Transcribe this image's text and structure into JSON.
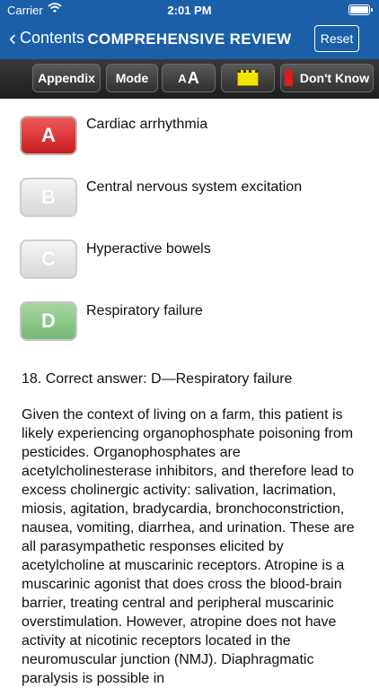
{
  "status_bar": {
    "carrier": "Carrier",
    "time": "2:01 PM"
  },
  "nav": {
    "back_label": "Contents",
    "title": "COMPREHENSIVE REVIEW",
    "reset_label": "Reset"
  },
  "toolbar": {
    "appendix_label": "Appendix",
    "mode_label": "Mode",
    "font_small": "A",
    "font_large": "A",
    "dont_know_label": "Don't Know"
  },
  "options": [
    {
      "letter": "A",
      "text": "Cardiac arrhythmia",
      "state": "selected-incorrect"
    },
    {
      "letter": "B",
      "text": "Central nervous system excitation",
      "state": "inactive"
    },
    {
      "letter": "C",
      "text": "Hyperactive bowels",
      "state": "inactive"
    },
    {
      "letter": "D",
      "text": "Respiratory failure",
      "state": "correct"
    }
  ],
  "answer_line": "18. Correct answer: D—Respiratory failure",
  "explanation": "Given the context of living on a farm, this patient is likely experiencing organophosphate poisoning from pesticides. Organophosphates are acetylcholinesterase inhibitors, and therefore lead to excess cholinergic activity: salivation, lacrimation, miosis, agitation, bradycardia, bronchoconstriction, nausea, vomiting, diarrhea, and urination. These are all parasympathetic responses elicited by acetylcholine at muscarinic receptors. Atropine is a muscarinic agonist that does cross the blood-brain barrier, treating central and peripheral muscarinic overstimulation. However, atropine does not have activity at nicotinic receptors located in the neuromuscular junction (NMJ). Diaphragmatic paralysis is possible in",
  "colors": {
    "nav_blue": "#1b5fa8",
    "toolbar_dark": "#2a2a2a",
    "option_red": "#d92a2a",
    "option_green": "#8cc685",
    "note_yellow": "#f2e200",
    "flag_red": "#e01b1b"
  },
  "icons": {
    "back": "chevron-left-icon",
    "wifi": "wifi-icon",
    "battery": "battery-icon",
    "note": "note-icon",
    "flag": "flag-icon"
  }
}
